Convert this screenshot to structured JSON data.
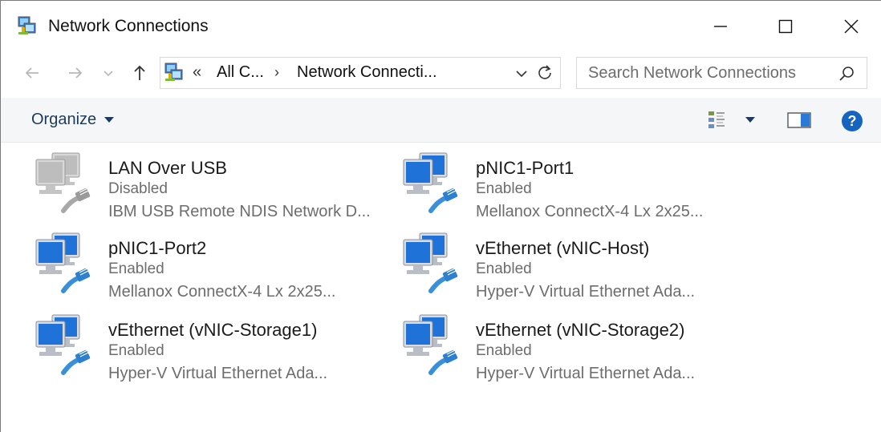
{
  "window": {
    "title": "Network Connections",
    "controls": [
      "minimize",
      "maximize",
      "close"
    ]
  },
  "navigation": {
    "address": {
      "overflow_chevron": "«",
      "crumbs": [
        "All C...",
        "Network Connecti..."
      ],
      "separator": "›"
    },
    "search": {
      "placeholder": "Search Network Connections",
      "value": ""
    }
  },
  "commandbar": {
    "organize_label": "Organize"
  },
  "connections": [
    {
      "name": "LAN Over USB",
      "status": "Disabled",
      "device": "IBM USB Remote NDIS Network D...",
      "state": "disabled"
    },
    {
      "name": "pNIC1-Port1",
      "status": "Enabled",
      "device": "Mellanox ConnectX-4 Lx 2x25...",
      "state": "enabled"
    },
    {
      "name": "pNIC1-Port2",
      "status": "Enabled",
      "device": "Mellanox ConnectX-4 Lx 2x25...",
      "state": "enabled"
    },
    {
      "name": "vEthernet (vNIC-Host)",
      "status": "Enabled",
      "device": "Hyper-V Virtual Ethernet Ada...",
      "state": "enabled"
    },
    {
      "name": "vEthernet (vNIC-Storage1)",
      "status": "Enabled",
      "device": "Hyper-V Virtual Ethernet Ada...",
      "state": "enabled"
    },
    {
      "name": "vEthernet (vNIC-Storage2)",
      "status": "Enabled",
      "device": "Hyper-V Virtual Ethernet Ada...",
      "state": "enabled"
    }
  ],
  "colors": {
    "accent": "#0a74da",
    "help": "#1565c0",
    "muted_text": "#6d6d6d",
    "commandbar_bg": "#f5f6f7"
  }
}
